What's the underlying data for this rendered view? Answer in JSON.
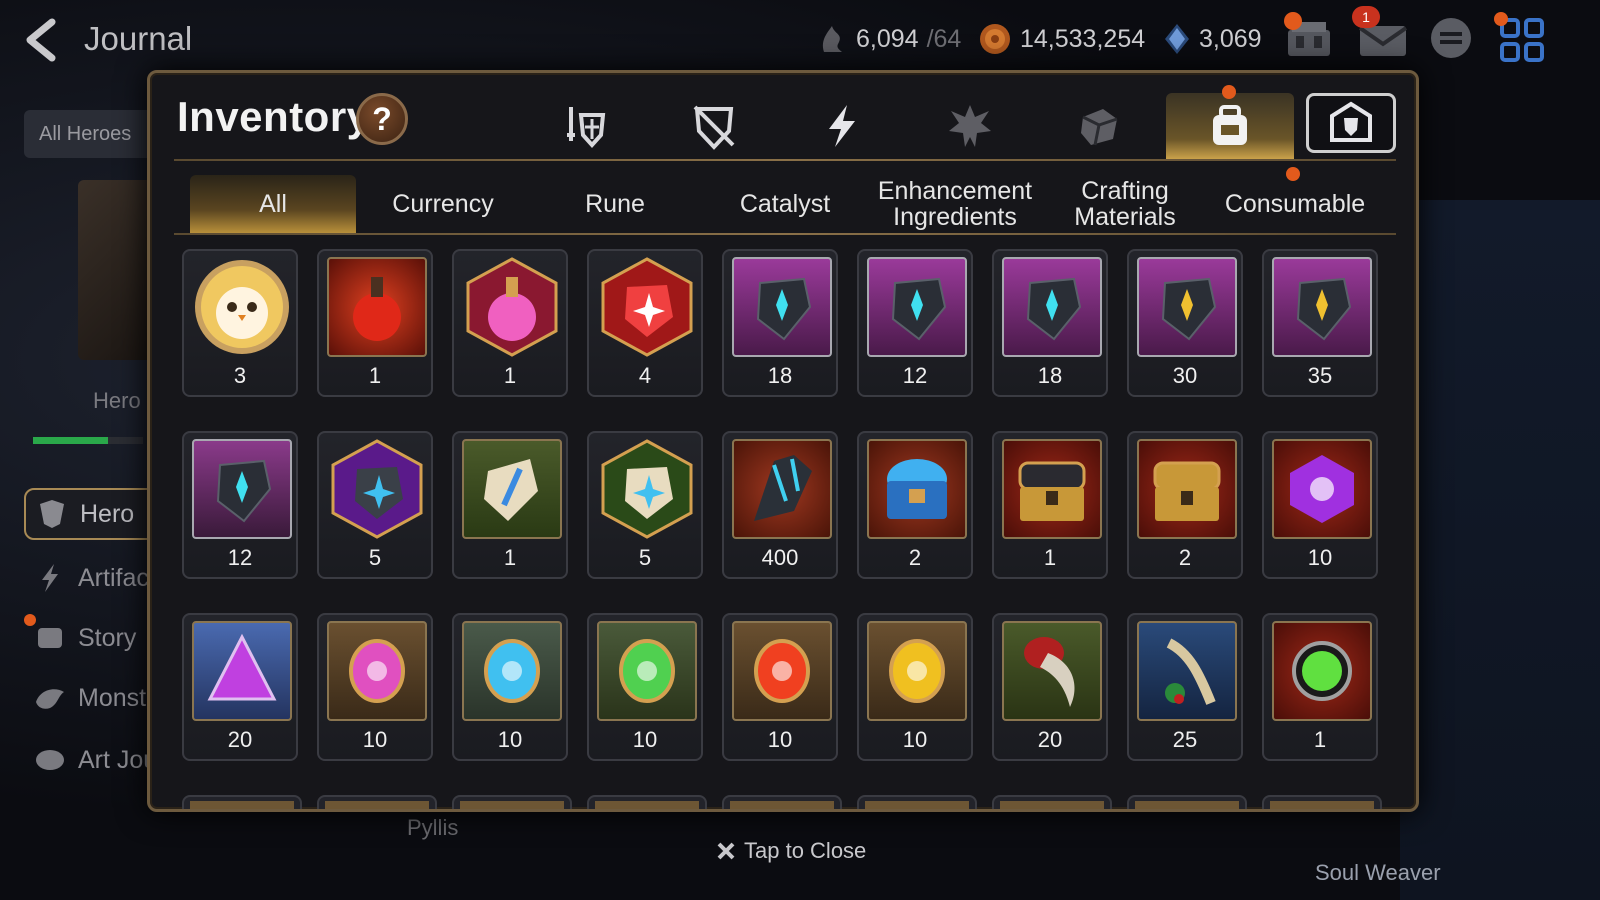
{
  "header": {
    "back_label": "back",
    "title": "Journal",
    "resources": [
      {
        "icon": "stamina-icon",
        "value": "6,094",
        "max": "/64"
      },
      {
        "icon": "gold-icon",
        "value": "14,533,254"
      },
      {
        "icon": "skystone-icon",
        "value": "3,069"
      }
    ],
    "mail_badge": "1"
  },
  "background": {
    "all_heroes": "All Heroes",
    "hero_label": "Hero",
    "menu": [
      "Hero",
      "Artifact",
      "Story",
      "Monster",
      "Art Journal"
    ],
    "pyllis": "Pyllis",
    "soul_weaver": "Soul Weaver"
  },
  "inventory": {
    "title": "Inventory",
    "help": "?",
    "category_tabs": [
      "equipment-icon",
      "broken-shield-icon",
      "lightning-icon",
      "monster-icon",
      "cube-icon",
      "bag-icon",
      "shield-gear-icon"
    ],
    "active_category": 5,
    "sub_tabs": [
      "All",
      "Currency",
      "Rune",
      "Catalyst",
      "Enhancement\nIngredients",
      "Crafting\nMaterials",
      "Consumable"
    ],
    "active_sub_tab": 0,
    "items": [
      {
        "icon": "chick-token-icon",
        "count": "3"
      },
      {
        "icon": "red-potion-icon",
        "count": "1"
      },
      {
        "icon": "pink-potion-icon",
        "count": "1"
      },
      {
        "icon": "red-crystal-icon",
        "count": "4"
      },
      {
        "icon": "sword-rune-stone-icon",
        "count": "18"
      },
      {
        "icon": "boot-rune-stone-icon",
        "count": "12"
      },
      {
        "icon": "armor-rune-stone-icon",
        "count": "18"
      },
      {
        "icon": "gold-rune-stone-icon",
        "count": "30"
      },
      {
        "icon": "hammer-rune-stone-icon",
        "count": "35"
      },
      {
        "icon": "swirl-rune-stone-icon",
        "count": "12"
      },
      {
        "icon": "purple-star-crystal-icon",
        "count": "5"
      },
      {
        "icon": "blue-sword-fossil-icon",
        "count": "1"
      },
      {
        "icon": "green-star-fossil-icon",
        "count": "5"
      },
      {
        "icon": "dark-crystal-shard-icon",
        "count": "400"
      },
      {
        "icon": "blue-chest-icon",
        "count": "2"
      },
      {
        "icon": "dark-chest-icon",
        "count": "1"
      },
      {
        "icon": "gold-chest-icon",
        "count": "2"
      },
      {
        "icon": "purple-moon-gem-icon",
        "count": "10"
      },
      {
        "icon": "purple-triangle-gem-icon",
        "count": "20"
      },
      {
        "icon": "pink-gem-icon",
        "count": "10"
      },
      {
        "icon": "ice-gem-icon",
        "count": "10"
      },
      {
        "icon": "green-gem-icon",
        "count": "10"
      },
      {
        "icon": "fire-gem-icon",
        "count": "10"
      },
      {
        "icon": "gold-gem-icon",
        "count": "10"
      },
      {
        "icon": "claw-icon",
        "count": "20"
      },
      {
        "icon": "root-icon",
        "count": "25"
      },
      {
        "icon": "green-orb-icon",
        "count": "1"
      }
    ]
  },
  "footer": {
    "close_label": "Tap to Close"
  }
}
